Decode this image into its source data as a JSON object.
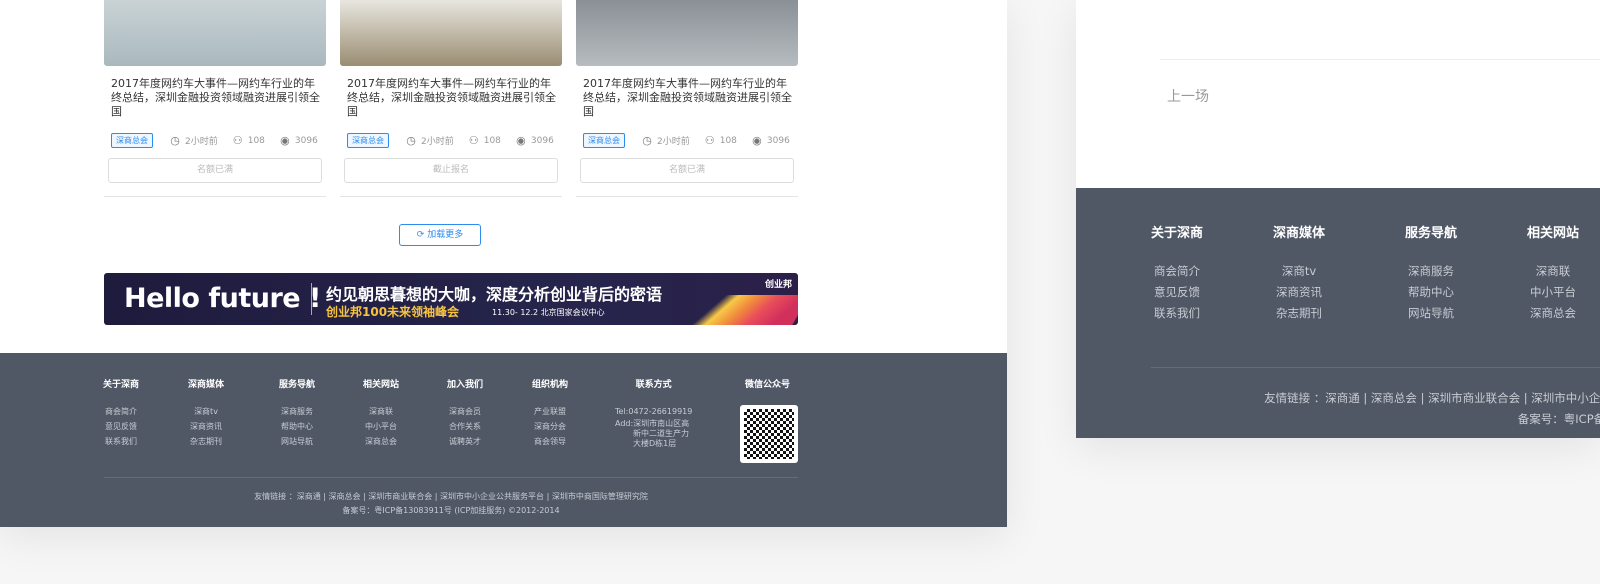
{
  "cards": [
    {
      "title": "2017年度网约车大事件—网约车行业的年终总结，深圳金融投资领域融资进展引领全国",
      "tag": "深商总会",
      "time": "2小时前",
      "participants": "108",
      "views": "3096",
      "button": "名额已满",
      "image_colors": [
        "#c9d3d6",
        "#aab8bd"
      ]
    },
    {
      "title": "2017年度网约车大事件—网约车行业的年终总结，深圳金融投资领域融资进展引领全国",
      "tag": "深商总会",
      "time": "2小时前",
      "participants": "108",
      "views": "3096",
      "button": "截止报名",
      "image_colors": [
        "#e8e6df",
        "#9a8d72"
      ]
    },
    {
      "title": "2017年度网约车大事件—网约车行业的年终总结，深圳金融投资领域融资进展引领全国",
      "tag": "深商总会",
      "time": "2小时前",
      "participants": "108",
      "views": "3096",
      "button": "名额已满",
      "image_colors": [
        "#8a9096",
        "#b7bcc0"
      ]
    }
  ],
  "load_more": "加载更多",
  "banner": {
    "hello": "Hello future !",
    "line1": "约见朝思暮想的大咖，深度分析创业背后的密语",
    "line2": "创业邦100未来领袖峰会",
    "line3": "11.30- 12.2 北京国家会议中心",
    "logo": "创业邦"
  },
  "footer": {
    "columns": [
      {
        "title": "关于深商",
        "items": [
          "商会简介",
          "意见反馈",
          "联系我们"
        ]
      },
      {
        "title": "深商媒体",
        "items": [
          "深商tv",
          "深商资讯",
          "杂志期刊"
        ]
      },
      {
        "title": "服务导航",
        "items": [
          "深商服务",
          "帮助中心",
          "网站导航"
        ]
      },
      {
        "title": "相关网站",
        "items": [
          "深商联",
          "中小平台",
          "深商总会"
        ]
      },
      {
        "title": "加入我们",
        "items": [
          "深商会员",
          "合作关系",
          "诚聘英才"
        ]
      },
      {
        "title": "组织机构",
        "items": [
          "产业联盟",
          "深商分会",
          "商会领导"
        ]
      }
    ],
    "contact": {
      "title": "联系方式",
      "tel": "Tel:0472-26619919",
      "address": [
        "Add:深圳市南山区高",
        "新中二道生产力",
        "大楼D栋1层"
      ]
    },
    "wechat": {
      "title": "微信公众号"
    },
    "friend_links": "友情链接 ：深商通 | 深商总会 | 深圳市商业联合会 | 深圳市中小企业公共服务平台 | 深圳市中商国际管理研究院",
    "icp": "备案号：粤ICP备13083911号 (ICP加挂服务) ©2012-2014"
  },
  "right_panel": {
    "prev": "上一场"
  },
  "colors": {
    "accent": "#2d8cf0",
    "footer_bg": "#505866"
  }
}
